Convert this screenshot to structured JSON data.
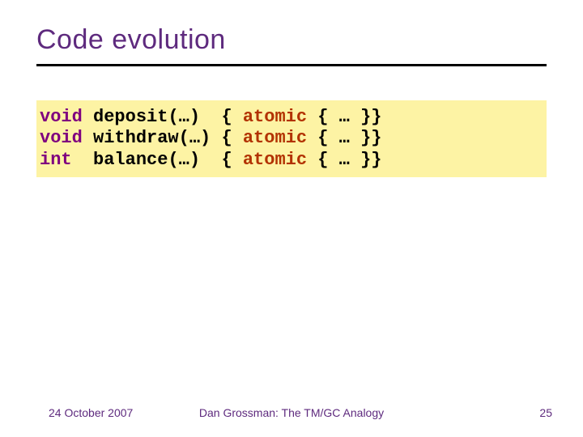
{
  "title": "Code evolution",
  "code": {
    "rows": [
      {
        "type": "void",
        "name": "deposit",
        "args": "(…) ",
        "open": " { ",
        "atomic": "atomic",
        "rest": " { … }}"
      },
      {
        "type": "void",
        "name": "withdraw",
        "args": "(…)",
        "open": " { ",
        "atomic": "atomic",
        "rest": " { … }}"
      },
      {
        "type": "int ",
        "name": "balance",
        "args": "(…) ",
        "open": " { ",
        "atomic": "atomic",
        "rest": " { … }}"
      }
    ]
  },
  "footer": {
    "date": "24 October 2007",
    "speaker": "Dan Grossman: The TM/GC Analogy",
    "page": "25"
  }
}
